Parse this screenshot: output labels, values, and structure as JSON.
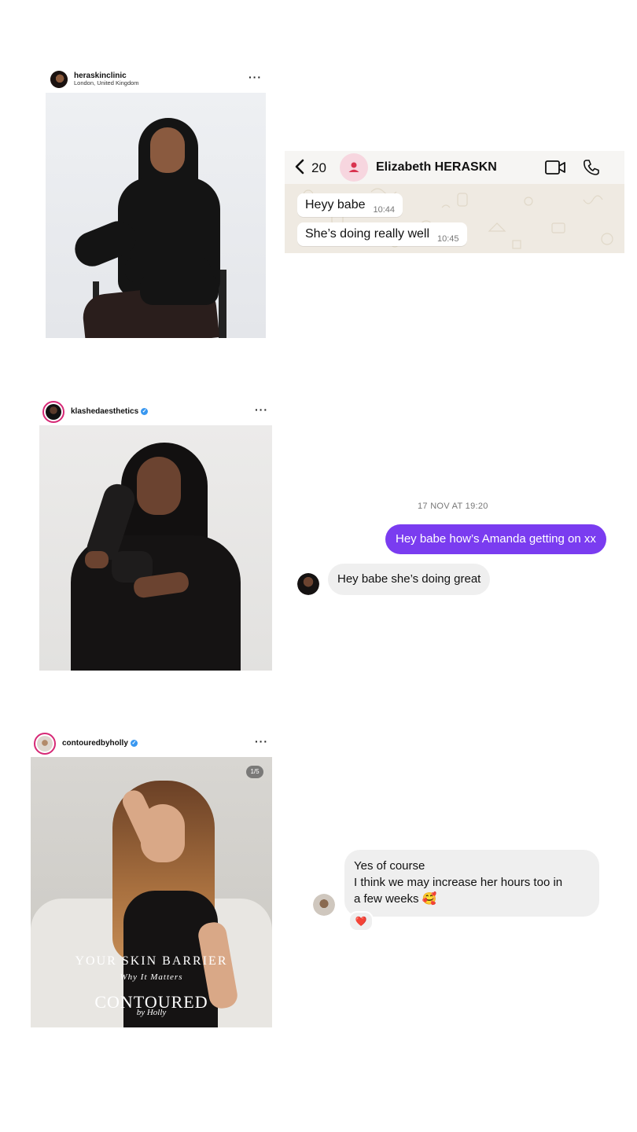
{
  "post1": {
    "handle": "heraskinclinic",
    "location": "London, United Kingdom",
    "more_icon": "more-dots-icon"
  },
  "whatsapp": {
    "back_count": "20",
    "contact_name": "Elizabeth HERASKN",
    "messages": [
      {
        "text": "Heyy babe",
        "time": "10:44"
      },
      {
        "text": "She’s doing really well",
        "time": "10:45"
      }
    ],
    "icons": [
      "back-chevron-icon",
      "contact-avatar-icon",
      "video-call-icon",
      "phone-call-icon"
    ]
  },
  "post2": {
    "handle": "klashedaesthetics",
    "verified": true,
    "more_icon": "more-dots-icon"
  },
  "dm1": {
    "date": "17 NOV AT 19:20",
    "outgoing": "Hey babe how’s Amanda getting on xx",
    "incoming": "Hey babe she’s doing great"
  },
  "post3": {
    "handle": "contouredbyholly",
    "verified": true,
    "more_icon": "more-dots-icon",
    "page_counter": "1/5",
    "overlay_title": "YOUR SKIN BARRIER",
    "overlay_subtitle": "Why It Matters",
    "overlay_brand": "CONTOURED",
    "overlay_script": "by Holly"
  },
  "dm2": {
    "line1": "Yes of course",
    "line2": "I think we may increase her hours too in",
    "line3": "a few weeks 🥰",
    "reaction": "❤️"
  },
  "colors": {
    "dm_outgoing": "#7a3cf0",
    "dm_incoming": "#efefef",
    "wa_background": "#efeae2",
    "wa_contact_avatar": "#f7d6df",
    "verified_blue": "#3897f0",
    "story_ring": "#d62976"
  }
}
